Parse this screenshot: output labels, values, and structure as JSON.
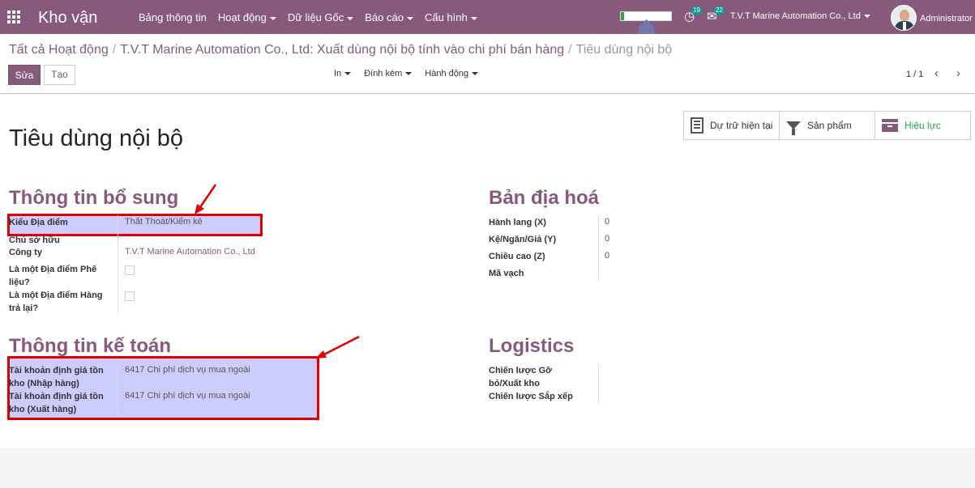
{
  "nav": {
    "brand": "Kho vận",
    "menu": [
      {
        "label": "Bảng thông tin",
        "dropdown": false
      },
      {
        "label": "Hoạt động",
        "dropdown": true
      },
      {
        "label": "Dữ liệu Gốc",
        "dropdown": true
      },
      {
        "label": "Báo cáo",
        "dropdown": true
      },
      {
        "label": "Cấu hình",
        "dropdown": true
      }
    ],
    "progress_fraction": 0.06,
    "activity_count": "19",
    "message_count": "22",
    "company": "T.V.T Marine Automation Co., Ltd",
    "user": "Administrator"
  },
  "breadcrumb": {
    "item1": "Tất cả Hoạt động",
    "item2": "T.V.T Marine Automation Co., Ltd: Xuất dùng nội bộ tính vào chi phí bán hàng",
    "current": "Tiêu dùng nội bộ"
  },
  "buttons": {
    "edit": "Sửa",
    "create": "Tạo"
  },
  "actions": {
    "print": "In",
    "attach": "Đính kèm",
    "action": "Hành động"
  },
  "pager": {
    "value": "1 / 1"
  },
  "smart_buttons": {
    "stock": "Dự trữ hiện tại",
    "products": "Sản phẩm",
    "active": "Hiệu lực"
  },
  "record_title": "Tiêu dùng nội bộ",
  "extra_info": {
    "title": "Thông tin bổ sung",
    "location_type_label": "Kiểu Địa điểm",
    "location_type_value": "Thất Thoát/Kiểm kê",
    "owner_label": "Chủ sở hữu",
    "company_label": "Công ty",
    "company_value": "T.V.T Marine Automation Co., Ltd",
    "scrap_label": "Là một Địa điểm Phế liệu?",
    "return_label": "Là một Địa điểm Hàng trả lại?"
  },
  "localization": {
    "title": "Bản địa hoá",
    "corridor_label": "Hành lang (X)",
    "corridor_value": "0",
    "shelves_label": "Kệ/Ngăn/Giá (Y)",
    "shelves_value": "0",
    "height_label": "Chiều cao (Z)",
    "height_value": "0",
    "barcode_label": "Mã vạch"
  },
  "accounting": {
    "title": "Thông tin kế toán",
    "in_label": "Tài khoản định giá tồn kho (Nhập hàng)",
    "in_value": "6417 Chi phí dịch vụ mua ngoài",
    "out_label": "Tài khoản định giá tồn kho (Xuất hàng)",
    "out_value": "6417 Chi phí dịch vụ mua ngoài"
  },
  "logistics": {
    "title": "Logistics",
    "removal_label": "Chiến lược Gỡ bỏ/Xuất kho",
    "putaway_label": "Chiến lược Sắp xếp"
  }
}
